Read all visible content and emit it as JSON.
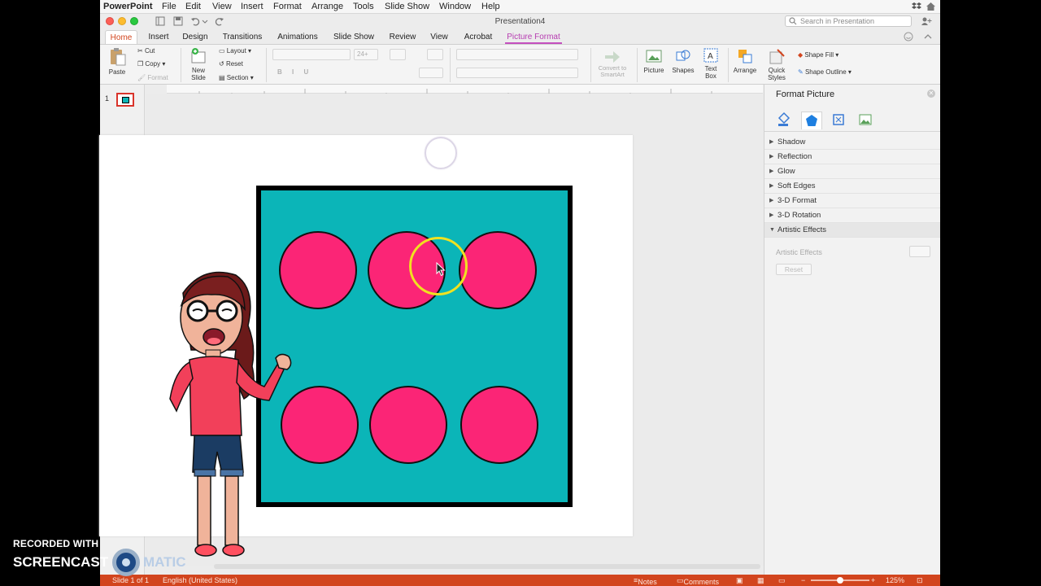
{
  "menubar": {
    "app_name": "PowerPoint",
    "items": [
      "File",
      "Edit",
      "View",
      "Insert",
      "Format",
      "Arrange",
      "Tools",
      "Slide Show",
      "Window",
      "Help"
    ]
  },
  "window": {
    "title": "Presentation4",
    "search_placeholder": "Search in Presentation"
  },
  "ribbon_tabs": [
    "Home",
    "Insert",
    "Design",
    "Transitions",
    "Animations",
    "Slide Show",
    "Review",
    "View",
    "Acrobat",
    "Picture Format"
  ],
  "ribbon": {
    "paste": "Paste",
    "cut": "Cut",
    "copy": "Copy",
    "format": "Format",
    "new_slide": "New\nSlide",
    "layout": "Layout",
    "reset": "Reset",
    "section": "Section",
    "font_size": "24+",
    "convert_smartart": "Convert to\nSmartArt",
    "picture": "Picture",
    "shapes": "Shapes",
    "text_box": "Text\nBox",
    "arrange": "Arrange",
    "quick_styles": "Quick\nStyles",
    "shape_fill": "Shape Fill",
    "shape_outline": "Shape Outline"
  },
  "thumbnails": {
    "slide_number": "1"
  },
  "format_pane": {
    "title": "Format Picture",
    "sections": [
      "Shadow",
      "Reflection",
      "Glow",
      "Soft Edges",
      "3-D Format",
      "3-D Rotation",
      "Artistic Effects"
    ],
    "open_section": "Artistic Effects",
    "artistic_effects_label": "Artistic Effects",
    "reset_label": "Reset"
  },
  "statusbar": {
    "slide_info": "Slide 1 of 1",
    "language": "English (United States)",
    "notes": "Notes",
    "comments": "Comments",
    "zoom": "125%"
  },
  "watermark": {
    "recorded_with": "RECORDED WITH",
    "screencast": "SCREENCAST",
    "matic": "MATIC"
  },
  "colors": {
    "accent": "#d2451e",
    "picture_bg": "#0bb5b8",
    "dot": "#fb2576"
  }
}
